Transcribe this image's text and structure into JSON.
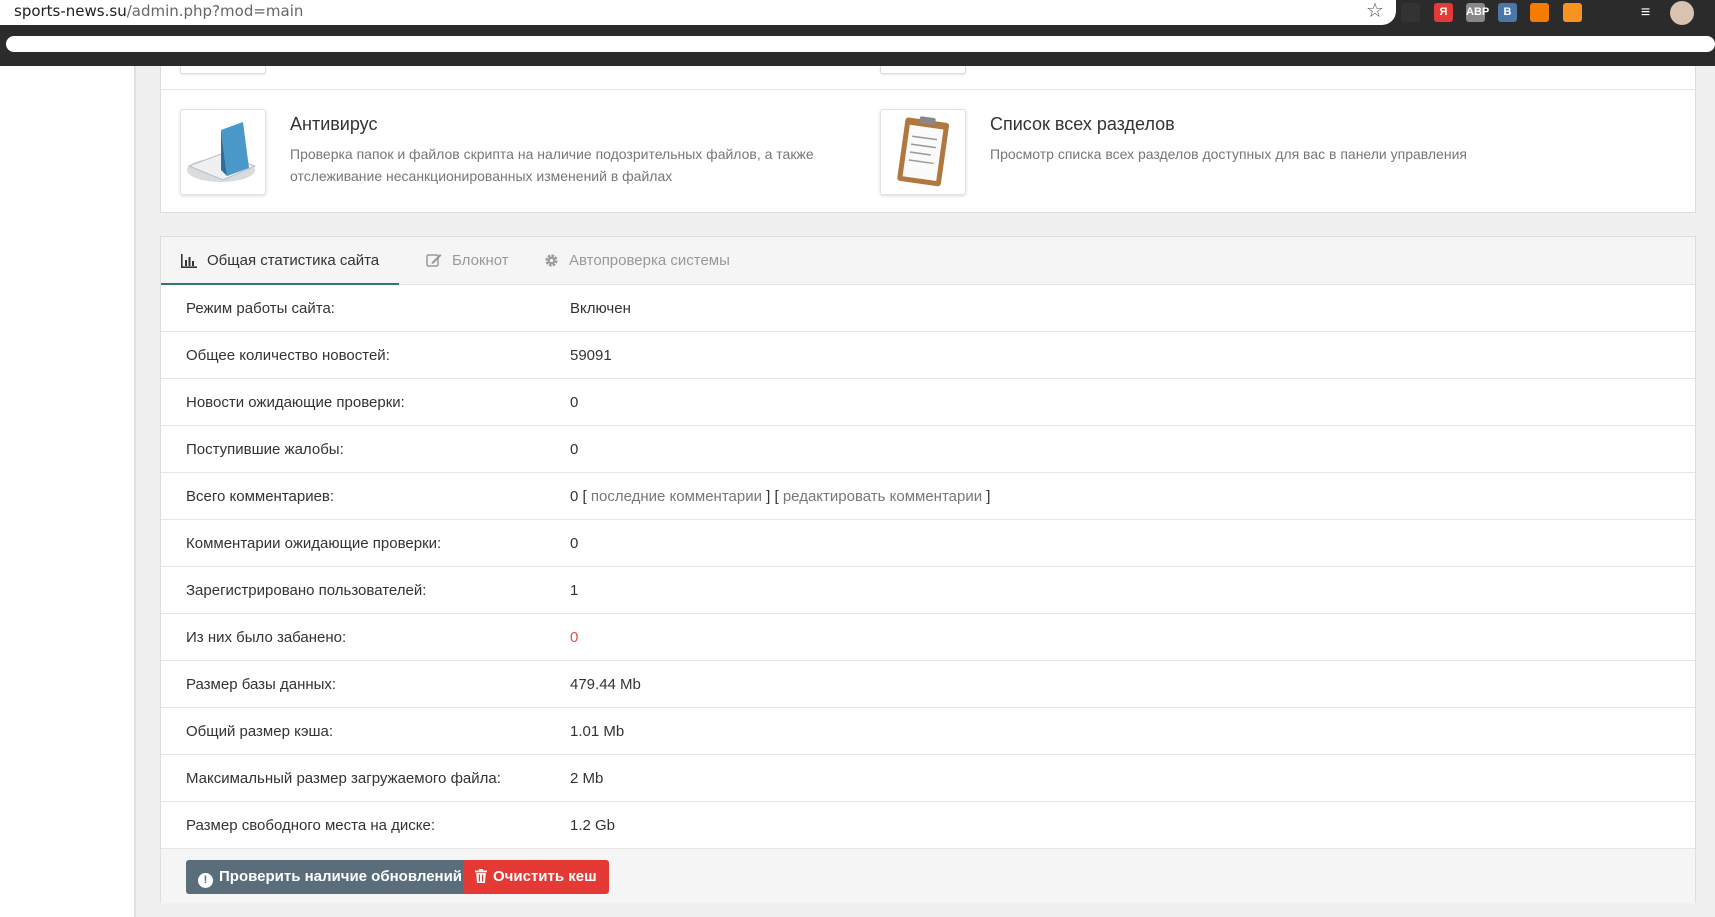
{
  "browser": {
    "url_host": "sports-news.su",
    "url_path": "/admin.php?mod=main",
    "extensions": [
      {
        "name": "ext-1",
        "label": "",
        "color": "#333333"
      },
      {
        "name": "yandex-icon",
        "label": "Я",
        "color": "#e53935"
      },
      {
        "name": "adblock-icon",
        "label": "ABP",
        "color": "#888888"
      },
      {
        "name": "vk-icon",
        "label": "В",
        "color": "#4a76a8"
      },
      {
        "name": "rss-icon",
        "label": "",
        "color": "#f57c00"
      },
      {
        "name": "odnoklassniki-icon",
        "label": "",
        "color": "#f7931e"
      }
    ]
  },
  "modules": [
    {
      "title": "Антивирус",
      "desc": "Проверка папок и файлов скрипта на наличие подозрительных файлов, а также отслеживание несанкционированных изменений в файлах"
    },
    {
      "title": "Список всех разделов",
      "desc": "Просмотр списка всех разделов доступных для вас в панели управления"
    }
  ],
  "tabs": [
    {
      "label": "Общая статистика сайта",
      "icon": "bar-chart-icon",
      "active": true
    },
    {
      "label": "Блокнот",
      "icon": "edit-icon",
      "active": false
    },
    {
      "label": "Автопроверка системы",
      "icon": "gear-icon",
      "active": false
    }
  ],
  "stats": [
    {
      "key": "Режим работы сайта:",
      "value": "Включен"
    },
    {
      "key": "Общее количество новостей:",
      "value": "59091"
    },
    {
      "key": "Новости ожидающие проверки:",
      "value": "0"
    },
    {
      "key": "Поступившие жалобы:",
      "value": "0"
    },
    {
      "key": "Всего комментариев:",
      "value": "0",
      "links": [
        "последние комментарии",
        "редактировать комментарии"
      ]
    },
    {
      "key": "Комментарии ожидающие проверки:",
      "value": "0"
    },
    {
      "key": "Зарегистрировано пользователей:",
      "value": "1"
    },
    {
      "key": "Из них было забанено:",
      "value": "0",
      "color": "#d9534f"
    },
    {
      "key": "Размер базы данных:",
      "value": "479.44 Mb"
    },
    {
      "key": "Общий размер кэша:",
      "value": "1.01 Mb"
    },
    {
      "key": "Максимальный размер загружаемого файла:",
      "value": "2 Mb"
    },
    {
      "key": "Размер свободного места на диске:",
      "value": "1.2 Gb"
    }
  ],
  "buttons": {
    "check_updates": "Проверить наличие обновлений",
    "clear_cache": "Очистить кеш"
  }
}
